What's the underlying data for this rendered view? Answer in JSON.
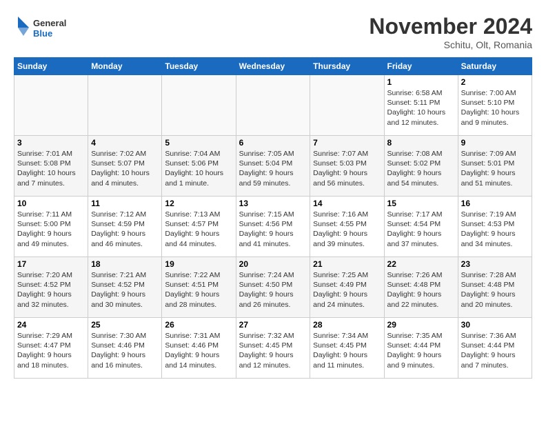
{
  "logo": {
    "line1": "General",
    "line2": "Blue"
  },
  "title": "November 2024",
  "subtitle": "Schitu, Olt, Romania",
  "weekdays": [
    "Sunday",
    "Monday",
    "Tuesday",
    "Wednesday",
    "Thursday",
    "Friday",
    "Saturday"
  ],
  "weeks": [
    [
      {
        "day": "",
        "info": ""
      },
      {
        "day": "",
        "info": ""
      },
      {
        "day": "",
        "info": ""
      },
      {
        "day": "",
        "info": ""
      },
      {
        "day": "",
        "info": ""
      },
      {
        "day": "1",
        "info": "Sunrise: 6:58 AM\nSunset: 5:11 PM\nDaylight: 10 hours and 12 minutes."
      },
      {
        "day": "2",
        "info": "Sunrise: 7:00 AM\nSunset: 5:10 PM\nDaylight: 10 hours and 9 minutes."
      }
    ],
    [
      {
        "day": "3",
        "info": "Sunrise: 7:01 AM\nSunset: 5:08 PM\nDaylight: 10 hours and 7 minutes."
      },
      {
        "day": "4",
        "info": "Sunrise: 7:02 AM\nSunset: 5:07 PM\nDaylight: 10 hours and 4 minutes."
      },
      {
        "day": "5",
        "info": "Sunrise: 7:04 AM\nSunset: 5:06 PM\nDaylight: 10 hours and 1 minute."
      },
      {
        "day": "6",
        "info": "Sunrise: 7:05 AM\nSunset: 5:04 PM\nDaylight: 9 hours and 59 minutes."
      },
      {
        "day": "7",
        "info": "Sunrise: 7:07 AM\nSunset: 5:03 PM\nDaylight: 9 hours and 56 minutes."
      },
      {
        "day": "8",
        "info": "Sunrise: 7:08 AM\nSunset: 5:02 PM\nDaylight: 9 hours and 54 minutes."
      },
      {
        "day": "9",
        "info": "Sunrise: 7:09 AM\nSunset: 5:01 PM\nDaylight: 9 hours and 51 minutes."
      }
    ],
    [
      {
        "day": "10",
        "info": "Sunrise: 7:11 AM\nSunset: 5:00 PM\nDaylight: 9 hours and 49 minutes."
      },
      {
        "day": "11",
        "info": "Sunrise: 7:12 AM\nSunset: 4:59 PM\nDaylight: 9 hours and 46 minutes."
      },
      {
        "day": "12",
        "info": "Sunrise: 7:13 AM\nSunset: 4:57 PM\nDaylight: 9 hours and 44 minutes."
      },
      {
        "day": "13",
        "info": "Sunrise: 7:15 AM\nSunset: 4:56 PM\nDaylight: 9 hours and 41 minutes."
      },
      {
        "day": "14",
        "info": "Sunrise: 7:16 AM\nSunset: 4:55 PM\nDaylight: 9 hours and 39 minutes."
      },
      {
        "day": "15",
        "info": "Sunrise: 7:17 AM\nSunset: 4:54 PM\nDaylight: 9 hours and 37 minutes."
      },
      {
        "day": "16",
        "info": "Sunrise: 7:19 AM\nSunset: 4:53 PM\nDaylight: 9 hours and 34 minutes."
      }
    ],
    [
      {
        "day": "17",
        "info": "Sunrise: 7:20 AM\nSunset: 4:52 PM\nDaylight: 9 hours and 32 minutes."
      },
      {
        "day": "18",
        "info": "Sunrise: 7:21 AM\nSunset: 4:52 PM\nDaylight: 9 hours and 30 minutes."
      },
      {
        "day": "19",
        "info": "Sunrise: 7:22 AM\nSunset: 4:51 PM\nDaylight: 9 hours and 28 minutes."
      },
      {
        "day": "20",
        "info": "Sunrise: 7:24 AM\nSunset: 4:50 PM\nDaylight: 9 hours and 26 minutes."
      },
      {
        "day": "21",
        "info": "Sunrise: 7:25 AM\nSunset: 4:49 PM\nDaylight: 9 hours and 24 minutes."
      },
      {
        "day": "22",
        "info": "Sunrise: 7:26 AM\nSunset: 4:48 PM\nDaylight: 9 hours and 22 minutes."
      },
      {
        "day": "23",
        "info": "Sunrise: 7:28 AM\nSunset: 4:48 PM\nDaylight: 9 hours and 20 minutes."
      }
    ],
    [
      {
        "day": "24",
        "info": "Sunrise: 7:29 AM\nSunset: 4:47 PM\nDaylight: 9 hours and 18 minutes."
      },
      {
        "day": "25",
        "info": "Sunrise: 7:30 AM\nSunset: 4:46 PM\nDaylight: 9 hours and 16 minutes."
      },
      {
        "day": "26",
        "info": "Sunrise: 7:31 AM\nSunset: 4:46 PM\nDaylight: 9 hours and 14 minutes."
      },
      {
        "day": "27",
        "info": "Sunrise: 7:32 AM\nSunset: 4:45 PM\nDaylight: 9 hours and 12 minutes."
      },
      {
        "day": "28",
        "info": "Sunrise: 7:34 AM\nSunset: 4:45 PM\nDaylight: 9 hours and 11 minutes."
      },
      {
        "day": "29",
        "info": "Sunrise: 7:35 AM\nSunset: 4:44 PM\nDaylight: 9 hours and 9 minutes."
      },
      {
        "day": "30",
        "info": "Sunrise: 7:36 AM\nSunset: 4:44 PM\nDaylight: 9 hours and 7 minutes."
      }
    ]
  ]
}
